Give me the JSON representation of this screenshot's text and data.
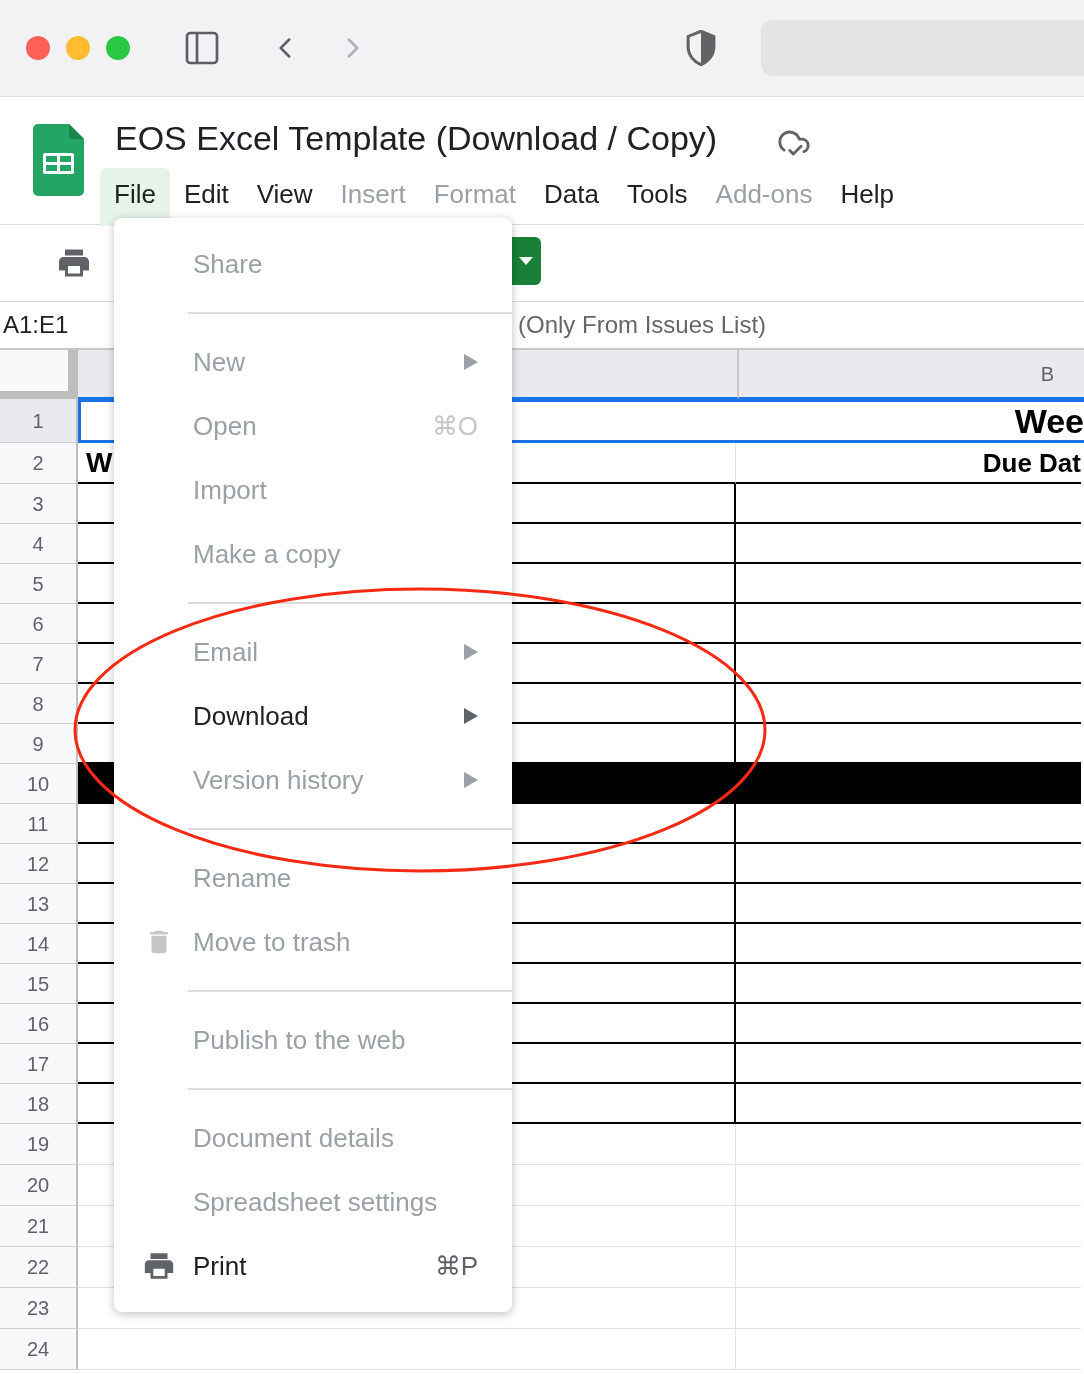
{
  "document": {
    "title": "EOS Excel Template (Download / Copy)"
  },
  "menu_bar": [
    {
      "label": "File",
      "selected": true,
      "disabled": false
    },
    {
      "label": "Edit",
      "selected": false,
      "disabled": false
    },
    {
      "label": "View",
      "selected": false,
      "disabled": false
    },
    {
      "label": "Insert",
      "selected": false,
      "disabled": true
    },
    {
      "label": "Format",
      "selected": false,
      "disabled": true
    },
    {
      "label": "Data",
      "selected": false,
      "disabled": false
    },
    {
      "label": "Tools",
      "selected": false,
      "disabled": false
    },
    {
      "label": "Add-ons",
      "selected": false,
      "disabled": true
    },
    {
      "label": "Help",
      "selected": false,
      "disabled": false
    }
  ],
  "name_box": "A1:E1",
  "formula": "(Only From Issues List)",
  "sheet": {
    "column_2": "B",
    "rows": [
      {
        "number": "1",
        "kind": "title",
        "selected": true,
        "b": "Wee"
      },
      {
        "number": "2",
        "kind": "heading",
        "selected": false,
        "a": "W",
        "b": "Due Dat"
      },
      {
        "number": "3",
        "kind": "box",
        "selected": false
      },
      {
        "number": "4",
        "kind": "box",
        "selected": false
      },
      {
        "number": "5",
        "kind": "box",
        "selected": false
      },
      {
        "number": "6",
        "kind": "box",
        "selected": false
      },
      {
        "number": "7",
        "kind": "box",
        "selected": false
      },
      {
        "number": "8",
        "kind": "box",
        "selected": false
      },
      {
        "number": "9",
        "kind": "box",
        "selected": false
      },
      {
        "number": "10",
        "kind": "filled",
        "selected": false
      },
      {
        "number": "11",
        "kind": "box",
        "selected": false
      },
      {
        "number": "12",
        "kind": "box",
        "selected": false
      },
      {
        "number": "13",
        "kind": "box",
        "selected": false
      },
      {
        "number": "14",
        "kind": "box",
        "selected": false
      },
      {
        "number": "15",
        "kind": "box",
        "selected": false
      },
      {
        "number": "16",
        "kind": "box",
        "selected": false
      },
      {
        "number": "17",
        "kind": "box",
        "selected": false
      },
      {
        "number": "18",
        "kind": "box",
        "selected": false
      },
      {
        "number": "19",
        "kind": "plain",
        "selected": false
      },
      {
        "number": "20",
        "kind": "plain",
        "selected": false
      },
      {
        "number": "21",
        "kind": "plain",
        "selected": false
      },
      {
        "number": "22",
        "kind": "plain",
        "selected": false
      },
      {
        "number": "23",
        "kind": "plain",
        "selected": false
      },
      {
        "number": "24",
        "kind": "plain",
        "selected": false
      }
    ]
  },
  "file_menu": {
    "sections": [
      [
        {
          "label": "Share",
          "kind": "plain",
          "disabled": true,
          "submenu": false
        }
      ],
      [
        {
          "label": "New",
          "kind": "plain",
          "disabled": true,
          "submenu": true
        },
        {
          "label": "Open",
          "kind": "plain",
          "disabled": true,
          "submenu": false,
          "shortcut": "⌘O"
        },
        {
          "label": "Import",
          "kind": "plain",
          "disabled": true,
          "submenu": false
        },
        {
          "label": "Make a copy",
          "kind": "plain",
          "disabled": true,
          "submenu": false
        }
      ],
      [
        {
          "label": "Email",
          "kind": "plain",
          "disabled": true,
          "submenu": true
        },
        {
          "label": "Download",
          "kind": "plain",
          "disabled": false,
          "submenu": true
        },
        {
          "label": "Version history",
          "kind": "plain",
          "disabled": true,
          "submenu": true
        }
      ],
      [
        {
          "label": "Rename",
          "kind": "plain",
          "disabled": true,
          "submenu": false
        },
        {
          "label": "Move to trash",
          "kind": "trash",
          "disabled": true,
          "submenu": false
        }
      ],
      [
        {
          "label": "Publish to the web",
          "kind": "plain",
          "disabled": true,
          "submenu": false
        }
      ],
      [
        {
          "label": "Document details",
          "kind": "plain",
          "disabled": true,
          "submenu": false
        },
        {
          "label": "Spreadsheet settings",
          "kind": "plain",
          "disabled": true,
          "submenu": false
        },
        {
          "label": "Print",
          "kind": "printer",
          "disabled": false,
          "submenu": false,
          "shortcut": "⌘P"
        }
      ]
    ]
  }
}
